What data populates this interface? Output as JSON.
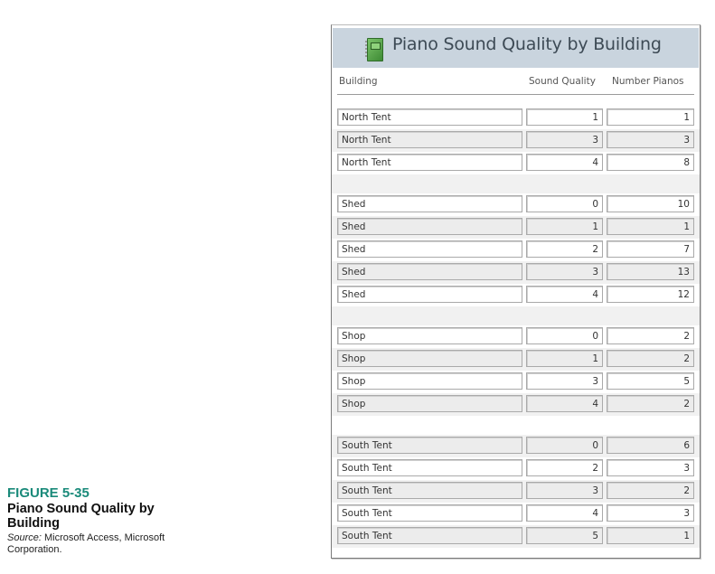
{
  "report": {
    "title": "Piano Sound Quality by Building",
    "icon": "report-notebook-icon",
    "columns": {
      "building": "Building",
      "sound_quality": "Sound Quality",
      "number_pianos": "Number Pianos"
    },
    "groups": [
      {
        "building": "North Tent",
        "rows": [
          {
            "building": "North Tent",
            "sound_quality": "1",
            "number_pianos": "1"
          },
          {
            "building": "North Tent",
            "sound_quality": "3",
            "number_pianos": "3"
          },
          {
            "building": "North Tent",
            "sound_quality": "4",
            "number_pianos": "8"
          }
        ]
      },
      {
        "building": "Shed",
        "rows": [
          {
            "building": "Shed",
            "sound_quality": "0",
            "number_pianos": "10"
          },
          {
            "building": "Shed",
            "sound_quality": "1",
            "number_pianos": "1"
          },
          {
            "building": "Shed",
            "sound_quality": "2",
            "number_pianos": "7"
          },
          {
            "building": "Shed",
            "sound_quality": "3",
            "number_pianos": "13"
          },
          {
            "building": "Shed",
            "sound_quality": "4",
            "number_pianos": "12"
          }
        ]
      },
      {
        "building": "Shop",
        "rows": [
          {
            "building": "Shop",
            "sound_quality": "0",
            "number_pianos": "2"
          },
          {
            "building": "Shop",
            "sound_quality": "1",
            "number_pianos": "2"
          },
          {
            "building": "Shop",
            "sound_quality": "3",
            "number_pianos": "5"
          },
          {
            "building": "Shop",
            "sound_quality": "4",
            "number_pianos": "2"
          }
        ]
      },
      {
        "building": "South Tent",
        "rows": [
          {
            "building": "South Tent",
            "sound_quality": "0",
            "number_pianos": "6"
          },
          {
            "building": "South Tent",
            "sound_quality": "2",
            "number_pianos": "3"
          },
          {
            "building": "South Tent",
            "sound_quality": "3",
            "number_pianos": "2"
          },
          {
            "building": "South Tent",
            "sound_quality": "4",
            "number_pianos": "3"
          },
          {
            "building": "South Tent",
            "sound_quality": "5",
            "number_pianos": "1"
          }
        ]
      }
    ]
  },
  "caption": {
    "figure": "FIGURE 5-35",
    "title": "Piano Sound Quality by Building",
    "source_label": "Source:",
    "source_text": " Microsoft Access, Microsoft Corporation."
  },
  "colors": {
    "header_band": "#c9d4de",
    "figure_label": "#1a8a7a",
    "alt_row": "#ececec"
  }
}
